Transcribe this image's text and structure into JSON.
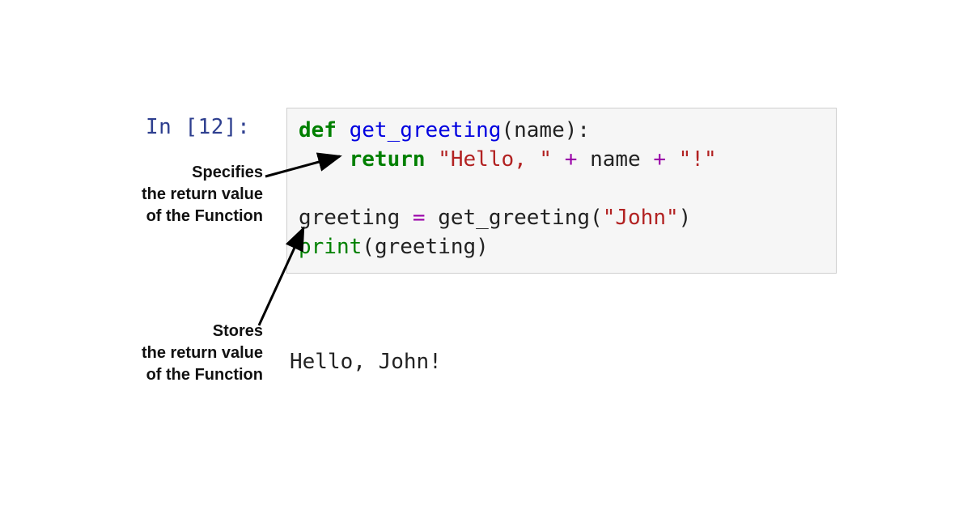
{
  "prompt": "In [12]:",
  "code": {
    "line1": {
      "def": "def",
      "fname": "get_greeting",
      "lparen": "(",
      "param": "name",
      "rparen": ")",
      "colon": ":"
    },
    "line2": {
      "indent": "    ",
      "ret": "return",
      "s1": "\"Hello, \"",
      "plus1": " + ",
      "nm": "name",
      "plus2": " + ",
      "s2": "\"!\""
    },
    "line3": "",
    "line4": {
      "var": "greeting",
      "eq": " = ",
      "call": "get_greeting",
      "lparen": "(",
      "arg": "\"John\"",
      "rparen": ")"
    },
    "line5": {
      "pr": "print",
      "lparen": "(",
      "arg": "greeting",
      "rparen": ")"
    }
  },
  "output": "Hello, John!",
  "annotations": {
    "label1_l1": "Specifies",
    "label1_l2": "the return value",
    "label1_l3": "of the Function",
    "label2_l1": "Stores",
    "label2_l2": "the return value",
    "label2_l3": "of the Function"
  }
}
